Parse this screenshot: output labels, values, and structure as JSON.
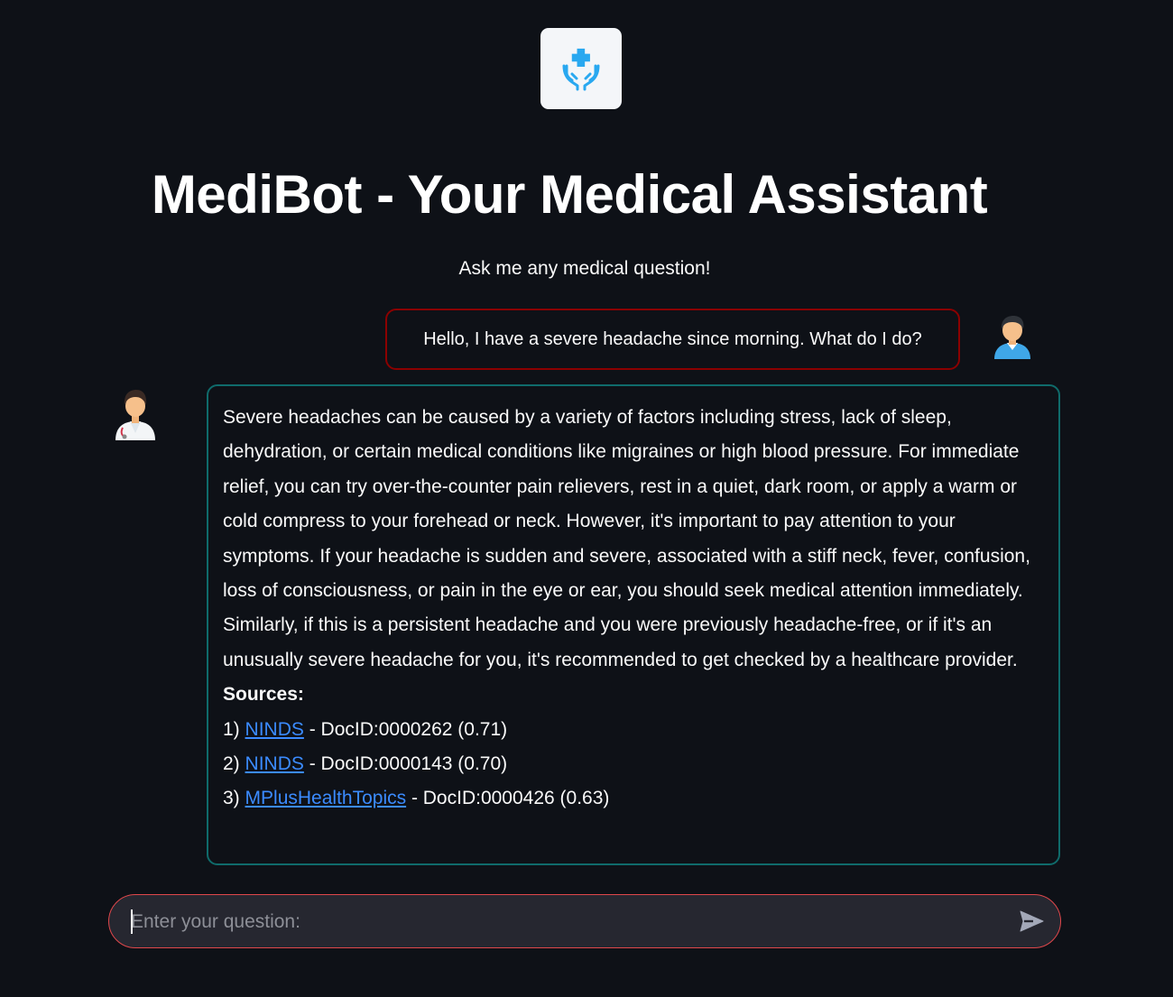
{
  "header": {
    "logo_icon": "medical-hands-icon",
    "title": "MediBot - Your Medical Assistant",
    "subtitle": "Ask me any medical question!"
  },
  "chat": {
    "messages": [
      {
        "role": "user",
        "avatar_icon": "user-avatar-icon",
        "text": "Hello, I have a severe headache since morning. What do I do?"
      },
      {
        "role": "assistant",
        "avatar_icon": "doctor-avatar-icon",
        "text": "Severe headaches can be caused by a variety of factors including stress, lack of sleep, dehydration, or certain medical conditions like migraines or high blood pressure. For immediate relief, you can try over-the-counter pain relievers, rest in a quiet, dark room, or apply a warm or cold compress to your forehead or neck. However, it's important to pay attention to your symptoms. If your headache is sudden and severe, associated with a stiff neck, fever, confusion, loss of consciousness, or pain in the eye or ear, you should seek medical attention immediately. Similarly, if this is a persistent headache and you were previously headache-free, or if it's an unusually severe headache for you, it's recommended to get checked by a healthcare provider.",
        "sources_heading": "Sources:",
        "sources": [
          {
            "index": "1)",
            "link": "NINDS",
            "detail": " - DocID:0000262 (0.71)"
          },
          {
            "index": "2)",
            "link": "NINDS",
            "detail": " - DocID:0000143 (0.70)"
          },
          {
            "index": "3)",
            "link": "MPlusHealthTopics",
            "detail": " - DocID:0000426 (0.63)"
          }
        ]
      }
    ]
  },
  "input": {
    "placeholder": "Enter your question:",
    "value": "",
    "send_icon": "send-icon"
  },
  "colors": {
    "background": "#0e1117",
    "user_border": "#8b0000",
    "assistant_border": "#0f6b6b",
    "link": "#3b8bff",
    "input_border": "#e0474b"
  }
}
